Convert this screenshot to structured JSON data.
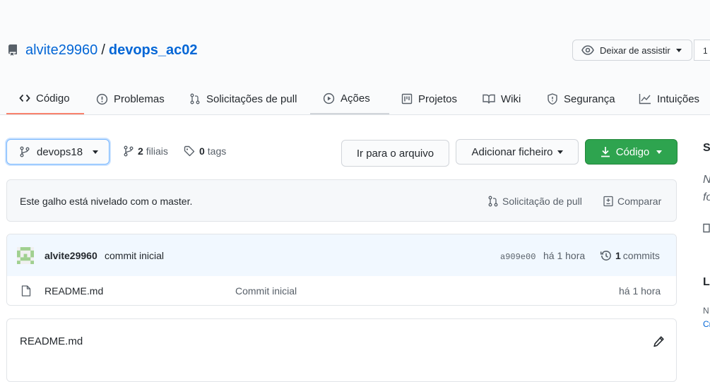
{
  "repo": {
    "owner": "alvite29960",
    "separator": "/",
    "name": "devops_ac02"
  },
  "watch": {
    "label": "Deixar de assistir",
    "count": "1"
  },
  "tabs": [
    {
      "label": "Código"
    },
    {
      "label": "Problemas"
    },
    {
      "label": "Solicitações de pull"
    },
    {
      "label": "Ações"
    },
    {
      "label": "Projetos"
    },
    {
      "label": "Wiki"
    },
    {
      "label": "Segurança"
    },
    {
      "label": "Intuições"
    }
  ],
  "branch": {
    "current": "devops18",
    "branches_count": "2",
    "branches_label": "filiais",
    "tags_count": "0",
    "tags_label": "tags"
  },
  "buttons": {
    "goto_file": "Ir para o arquivo",
    "add_file": "Adicionar ficheiro",
    "code": "Código"
  },
  "flash": {
    "message": "Este galho está nivelado com o master.",
    "pull_request": "Solicitação de pull",
    "compare": "Comparar"
  },
  "last_commit": {
    "author": "alvite29960",
    "message": "commit inicial",
    "sha": "a909e00",
    "time": "há 1 hora",
    "commits_count": "1",
    "commits_label": "commits"
  },
  "files": [
    {
      "name": "README.md",
      "message": "Commit inicial",
      "time": "há 1 hora"
    }
  ],
  "readme": {
    "title": "README.md"
  },
  "sidebar": {
    "s": "S",
    "n1": "N",
    "fo": "fo",
    "la": "La",
    "n2": "N",
    "cr": "Cr"
  },
  "colors": {
    "accent": "#0366d6",
    "green": "#2ea44f",
    "tab_underline": "#f9826c",
    "commit_bg": "#f1f8ff"
  }
}
